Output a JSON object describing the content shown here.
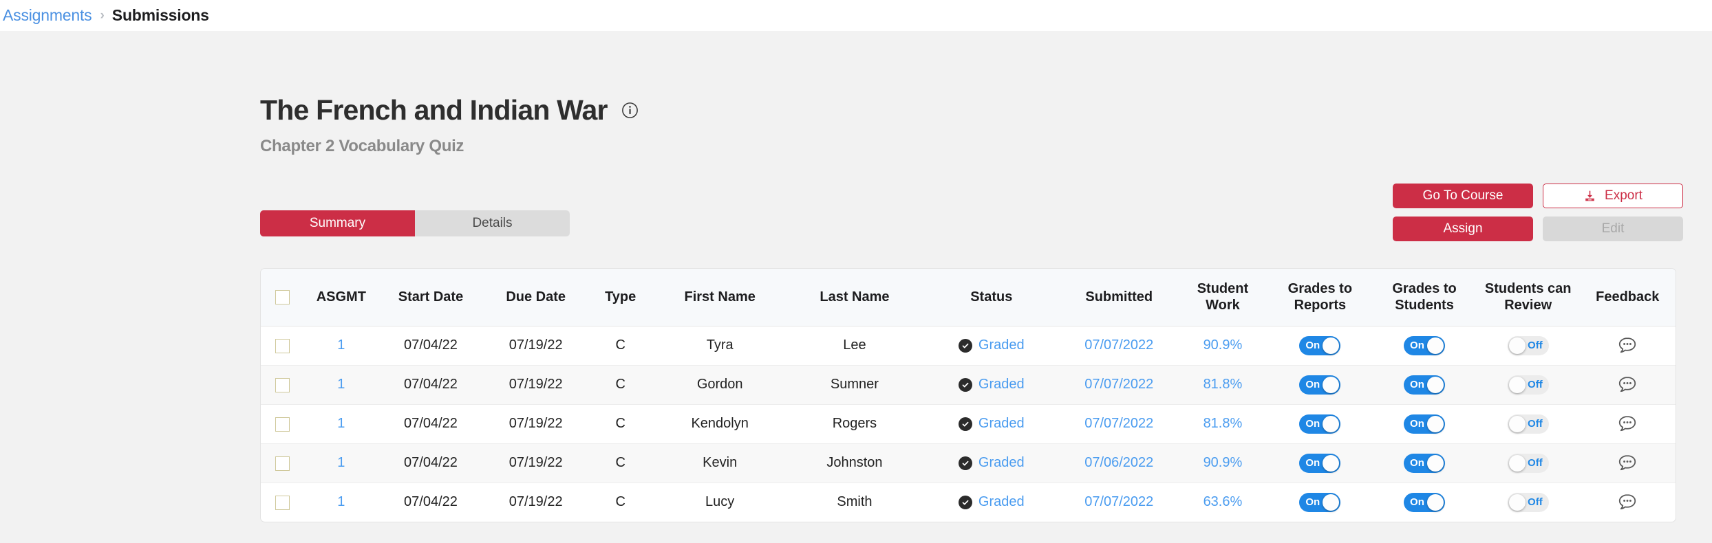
{
  "breadcrumb": {
    "parent": "Assignments",
    "separator": "›",
    "current": "Submissions"
  },
  "header": {
    "title": "The French and Indian War",
    "subtitle": "Chapter 2 Vocabulary Quiz",
    "info_icon": "info-circle-icon"
  },
  "actions": {
    "go_to_course": "Go To Course",
    "export": "Export",
    "export_icon": "download-icon",
    "assign": "Assign",
    "edit": "Edit"
  },
  "tabs": [
    {
      "label": "Summary",
      "active": true
    },
    {
      "label": "Details",
      "active": false
    }
  ],
  "colors": {
    "brand_red": "#cc2e46",
    "link_blue": "#4a9cf0",
    "toggle_on_blue": "#1f87e5",
    "page_bg": "#f2f2f2",
    "header_row_bg": "#f7f9fb",
    "checkbox_border": "#cfc89a"
  },
  "table": {
    "columns": [
      "",
      "ASGMT",
      "Start Date",
      "Due Date",
      "Type",
      "First Name",
      "Last Name",
      "Status",
      "Submitted",
      "Student Work",
      "Grades to Reports",
      "Grades to Students",
      "Students can Review",
      "Feedback"
    ],
    "select_all_checkbox": false,
    "rows": [
      {
        "checkbox": false,
        "asgmt": "1",
        "start_date": "07/04/22",
        "due_date": "07/19/22",
        "type": "C",
        "first_name": "Tyra",
        "last_name": "Lee",
        "status": "Graded",
        "status_icon": "check-circle-icon",
        "submitted": "07/07/2022",
        "student_work": "90.9%",
        "grades_to_reports": "On",
        "grades_to_students": "On",
        "students_can_review": "Off",
        "feedback_icon": "comment-dots-icon"
      },
      {
        "checkbox": false,
        "asgmt": "1",
        "start_date": "07/04/22",
        "due_date": "07/19/22",
        "type": "C",
        "first_name": "Gordon",
        "last_name": "Sumner",
        "status": "Graded",
        "status_icon": "check-circle-icon",
        "submitted": "07/07/2022",
        "student_work": "81.8%",
        "grades_to_reports": "On",
        "grades_to_students": "On",
        "students_can_review": "Off",
        "feedback_icon": "comment-dots-icon"
      },
      {
        "checkbox": false,
        "asgmt": "1",
        "start_date": "07/04/22",
        "due_date": "07/19/22",
        "type": "C",
        "first_name": "Kendolyn",
        "last_name": "Rogers",
        "status": "Graded",
        "status_icon": "check-circle-icon",
        "submitted": "07/07/2022",
        "student_work": "81.8%",
        "grades_to_reports": "On",
        "grades_to_students": "On",
        "students_can_review": "Off",
        "feedback_icon": "comment-dots-icon"
      },
      {
        "checkbox": false,
        "asgmt": "1",
        "start_date": "07/04/22",
        "due_date": "07/19/22",
        "type": "C",
        "first_name": "Kevin",
        "last_name": "Johnston",
        "status": "Graded",
        "status_icon": "check-circle-icon",
        "submitted": "07/06/2022",
        "student_work": "90.9%",
        "grades_to_reports": "On",
        "grades_to_students": "On",
        "students_can_review": "Off",
        "feedback_icon": "comment-dots-icon"
      },
      {
        "checkbox": false,
        "asgmt": "1",
        "start_date": "07/04/22",
        "due_date": "07/19/22",
        "type": "C",
        "first_name": "Lucy",
        "last_name": "Smith",
        "status": "Graded",
        "status_icon": "check-circle-icon",
        "submitted": "07/07/2022",
        "student_work": "63.6%",
        "grades_to_reports": "On",
        "grades_to_students": "On",
        "students_can_review": "Off",
        "feedback_icon": "comment-dots-icon"
      }
    ]
  }
}
